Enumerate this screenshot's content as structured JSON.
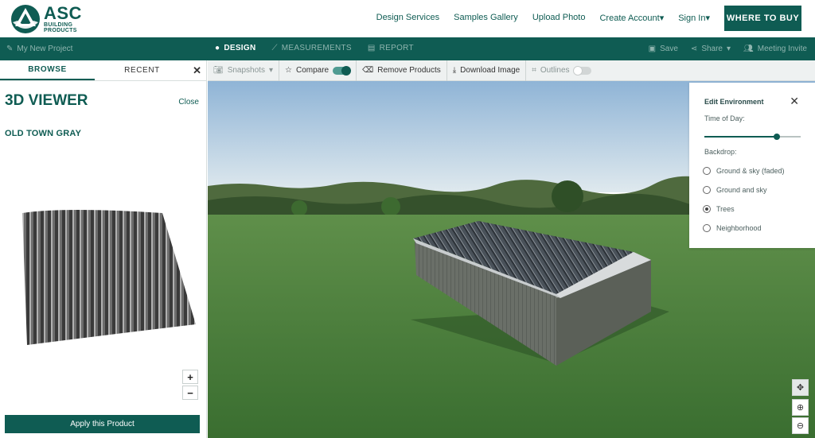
{
  "brand": {
    "name": "ASC",
    "sub1": "BUILDING",
    "sub2": "PRODUCTS"
  },
  "topnav": {
    "items": [
      "Design Services",
      "Samples Gallery",
      "Upload Photo",
      "Create Account▾",
      "Sign In▾"
    ],
    "cta": "WHERE TO BUY"
  },
  "mainbar": {
    "project": "My New Project",
    "tabs": [
      {
        "label": "DESIGN",
        "active": true
      },
      {
        "label": "MEASUREMENTS",
        "active": false
      },
      {
        "label": "REPORT",
        "active": false
      }
    ],
    "save": "Save",
    "share": "Share",
    "meeting": "Meeting Invite"
  },
  "left": {
    "tabs": [
      "BROWSE",
      "RECENT"
    ],
    "close_x": "✕",
    "viewer_title": "3D VIEWER",
    "viewer_close": "Close",
    "product": "OLD TOWN GRAY",
    "zoom_in": "+",
    "zoom_out": "−",
    "apply": "Apply this Product"
  },
  "toolbar": {
    "snapshots": "Snapshots",
    "compare": "Compare",
    "compare_on": true,
    "remove": "Remove Products",
    "download": "Download Image",
    "outlines": "Outlines",
    "outlines_on": false
  },
  "environment": {
    "title": "Edit Environment",
    "time_label": "Time of Day:",
    "time_value": 0.75,
    "backdrop_label": "Backdrop:",
    "options": [
      {
        "label": "Ground & sky (faded)",
        "checked": false
      },
      {
        "label": "Ground and sky",
        "checked": false
      },
      {
        "label": "Trees",
        "checked": true
      },
      {
        "label": "Neighborhood",
        "checked": false
      }
    ]
  },
  "colors": {
    "brand": "#0f5c53",
    "grass": "#3f7a36",
    "sky": "#b9d3e6"
  }
}
